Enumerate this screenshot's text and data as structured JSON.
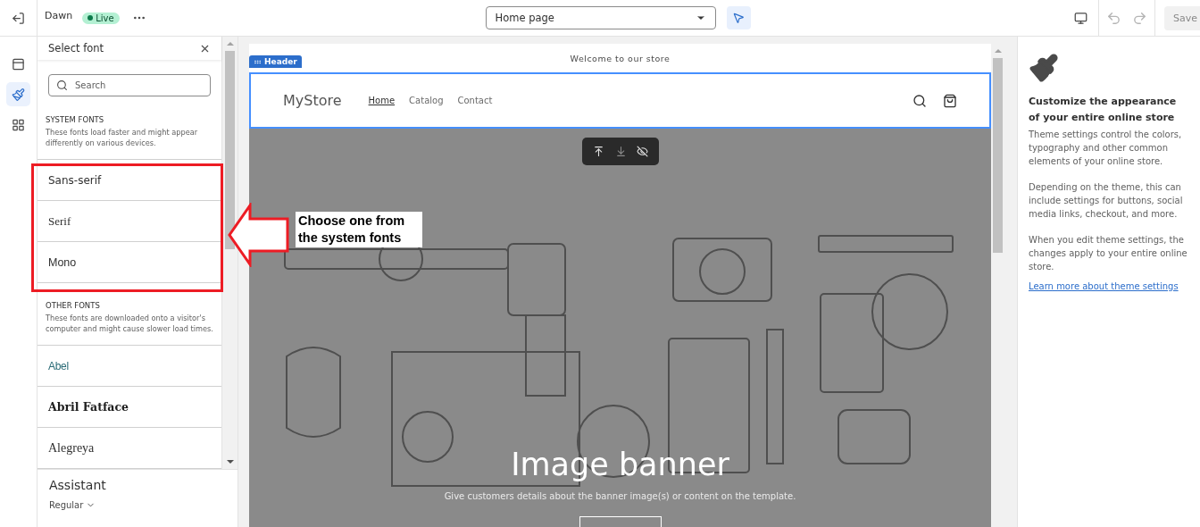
{
  "topbar": {
    "theme_name": "Dawn",
    "status": "Live",
    "page_select": "Home page",
    "save": "Save"
  },
  "rail": [
    {
      "kind": "sections",
      "selected": false
    },
    {
      "kind": "theme",
      "selected": true
    },
    {
      "kind": "apps",
      "selected": false
    }
  ],
  "font_panel": {
    "title": "Select font",
    "search": {
      "placeholder": "Search"
    },
    "sections": [
      {
        "heading": "SYSTEM FONTS",
        "description": "These fonts load faster and might appear differently on various devices.",
        "fonts": [
          {
            "name": "Sans-serif",
            "kind": "sans"
          },
          {
            "name": "Serif",
            "kind": "serif"
          },
          {
            "name": "Mono",
            "kind": "mono"
          }
        ]
      },
      {
        "heading": "OTHER FONTS",
        "description": "These fonts are downloaded onto a visitor's computer and might cause slower load times.",
        "fonts": [
          {
            "name": "Abel",
            "kind": "condensed"
          },
          {
            "name": "Abril Fatface",
            "kind": "display"
          },
          {
            "name": "Alegreya",
            "kind": "oldstyle"
          }
        ]
      }
    ],
    "current": {
      "name": "Assistant",
      "weight": "Regular"
    }
  },
  "preview": {
    "announcement": "Welcome to our store",
    "section_tag": "Header",
    "logo": "MyStore",
    "nav": [
      {
        "label": "Home",
        "selected": true
      },
      {
        "label": "Catalog",
        "selected": false
      },
      {
        "label": "Contact",
        "selected": false
      }
    ],
    "banner": {
      "title": "Image banner",
      "text": "Give customers details about the banner image(s) or content on the template."
    }
  },
  "annotation": {
    "text": "Choose one from the system fonts"
  },
  "settings_panel": {
    "title": "Customize the appearance of your entire online store",
    "paragraphs": [
      "Theme settings control the colors, typography and other common elements of your online store.",
      "Depending on the theme, this can include settings for buttons, social media links, checkout, and more.",
      "When you edit theme settings, the changes apply to your entire online store."
    ],
    "link": "Learn more about theme settings"
  }
}
